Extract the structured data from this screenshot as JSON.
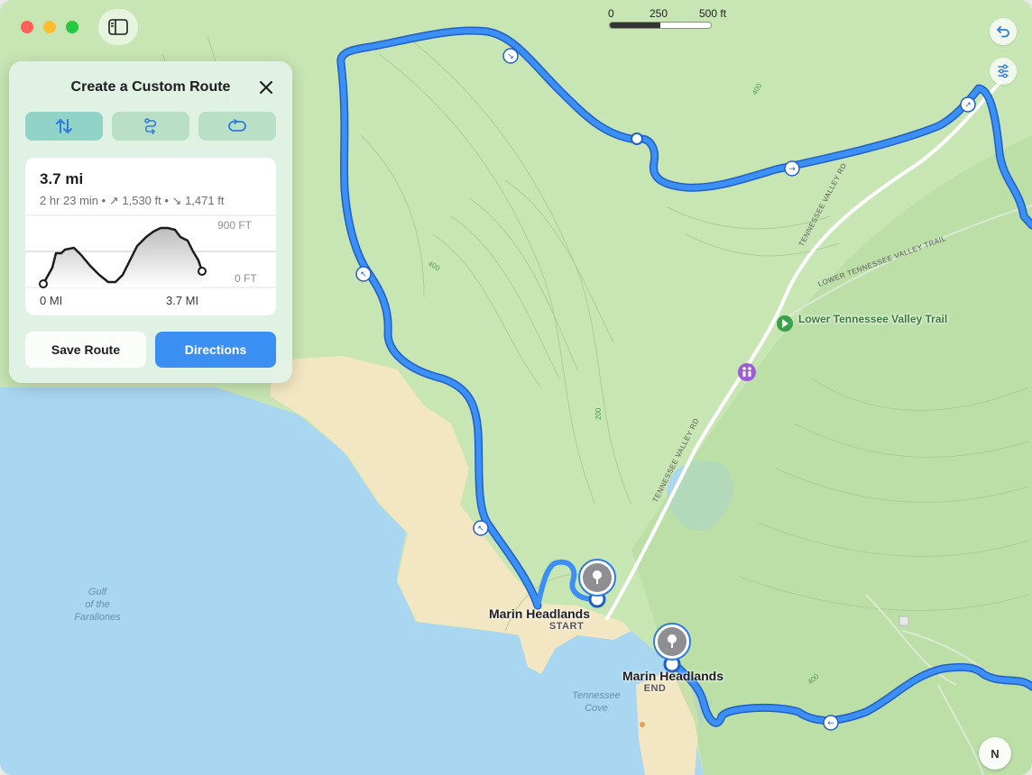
{
  "window": {
    "controls": [
      "close",
      "minimize",
      "zoom"
    ],
    "sidebar_toggle_icon": "sidebar-icon"
  },
  "toolbar": {
    "undo_icon": "undo-arrow-icon",
    "route_options_icon": "route-options-icon"
  },
  "scale": {
    "labels": [
      "0",
      "250",
      "500 ft"
    ]
  },
  "panel": {
    "title": "Create a Custom Route",
    "close_icon": "close-icon",
    "segments": [
      {
        "icon": "reverse-route-icon",
        "active": true
      },
      {
        "icon": "out-and-back-icon",
        "active": false
      },
      {
        "icon": "loop-icon",
        "active": false
      }
    ],
    "distance": "3.7 mi",
    "duration": "2 hr 23 min",
    "ascent": "1,530 ft",
    "descent": "1,471 ft",
    "elevation_chart": {
      "y_labels": [
        "900 FT",
        "0 FT"
      ],
      "x_labels": [
        "0 MI",
        "3.7 MI"
      ]
    },
    "save_label": "Save Route",
    "directions_label": "Directions"
  },
  "map": {
    "start": {
      "name": "Marin Headlands",
      "label": "START"
    },
    "end": {
      "name": "Marin Headlands",
      "label": "END"
    },
    "water_labels": [
      "Gulf\nof the\nFarallones",
      "Tennessee\nCove"
    ],
    "roads": [
      "TENNESSEE VALLEY RD",
      "TENNESSEE VALLEY RD",
      "LOWER TENNESSEE VALLEY TRAIL"
    ],
    "poi": {
      "name": "Lower Tennessee Valley Trail",
      "icon": "trailhead-icon"
    },
    "restroom_icon": "restroom-icon",
    "contour_labels": [
      "400",
      "400",
      "200",
      "400"
    ],
    "colors": {
      "route": "#2f7be6",
      "land": "#c8e6b4",
      "water": "#a9d6f0",
      "sand": "#f3e7c3"
    }
  },
  "compass": {
    "label": "N"
  }
}
